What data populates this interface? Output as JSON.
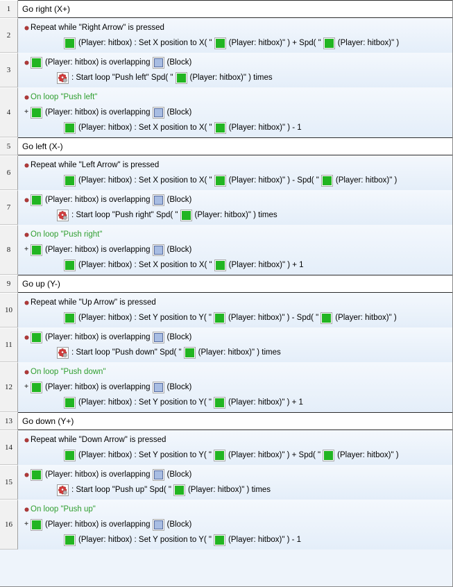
{
  "app": {
    "view": "event-list-editor",
    "colors": {
      "row_bg_top": "#f4f8fd",
      "row_bg_bottom": "#e4eef9",
      "comment_bg": "#ffffff",
      "gutter_bg": "#f1f1f1",
      "player_icon": "#22b522",
      "block_icon": "#a8bde3",
      "loop_text": "#2f9e2f",
      "bullet": "#b03a3a"
    },
    "labels": {
      "player_obj": "(Player: hitbox)",
      "block_obj": "(Block)",
      "overlapping": "is overlapping",
      "times": ") times",
      "quote": "\""
    }
  },
  "rows": [
    {
      "num": "1",
      "type": "comment",
      "text": "Go right (X+)"
    },
    {
      "num": "2",
      "type": "event",
      "lines": [
        {
          "kind": "cond",
          "marker": "red",
          "indent": 0,
          "parts": [
            {
              "t": "text",
              "v": "Repeat while \"Right Arrow\" is pressed"
            }
          ]
        },
        {
          "kind": "act",
          "marker": "none",
          "indent": 2,
          "parts": [
            {
              "t": "icon",
              "v": "player-green-icon"
            },
            {
              "t": "text",
              "v": "(Player: hitbox) : Set X position to X( \""
            },
            {
              "t": "icon",
              "v": "player-green-icon"
            },
            {
              "t": "text",
              "v": "(Player: hitbox)\" ) + Spd( \""
            },
            {
              "t": "icon",
              "v": "player-green-icon"
            },
            {
              "t": "text",
              "v": "(Player: hitbox)\" )"
            }
          ]
        }
      ]
    },
    {
      "num": "3",
      "type": "event",
      "lines": [
        {
          "kind": "cond",
          "marker": "red",
          "indent": 0,
          "parts": [
            {
              "t": "icon",
              "v": "player-green-icon"
            },
            {
              "t": "text",
              "v": "(Player: hitbox) is overlapping"
            },
            {
              "t": "icon",
              "v": "block-blue-icon"
            },
            {
              "t": "text",
              "v": "(Block)"
            }
          ]
        },
        {
          "kind": "act",
          "marker": "none",
          "indent": 3,
          "parts": [
            {
              "t": "icon",
              "v": "special-loop-gear-icon"
            },
            {
              "t": "text",
              "v": ": Start loop \"Push left\" Spd( \""
            },
            {
              "t": "icon",
              "v": "player-green-icon"
            },
            {
              "t": "text",
              "v": "(Player: hitbox)\" ) times"
            }
          ]
        }
      ]
    },
    {
      "num": "4",
      "type": "event",
      "lines": [
        {
          "kind": "cond",
          "marker": "red",
          "indent": 0,
          "green": true,
          "parts": [
            {
              "t": "text",
              "v": "On loop \"Push left\""
            }
          ]
        },
        {
          "kind": "subcond",
          "marker": "plus",
          "indent": 0,
          "parts": [
            {
              "t": "icon",
              "v": "player-green-icon"
            },
            {
              "t": "text",
              "v": "(Player: hitbox) is overlapping"
            },
            {
              "t": "icon",
              "v": "block-blue-icon"
            },
            {
              "t": "text",
              "v": "(Block)"
            }
          ]
        },
        {
          "kind": "act",
          "marker": "none",
          "indent": 2,
          "parts": [
            {
              "t": "icon",
              "v": "player-green-icon"
            },
            {
              "t": "text",
              "v": "(Player: hitbox) : Set X position to X( \""
            },
            {
              "t": "icon",
              "v": "player-green-icon"
            },
            {
              "t": "text",
              "v": "(Player: hitbox)\" ) - 1"
            }
          ]
        }
      ]
    },
    {
      "num": "5",
      "type": "comment",
      "text": "Go left (X-)"
    },
    {
      "num": "6",
      "type": "event",
      "lines": [
        {
          "kind": "cond",
          "marker": "red",
          "indent": 0,
          "parts": [
            {
              "t": "text",
              "v": "Repeat while \"Left Arrow\" is pressed"
            }
          ]
        },
        {
          "kind": "act",
          "marker": "none",
          "indent": 2,
          "parts": [
            {
              "t": "icon",
              "v": "player-green-icon"
            },
            {
              "t": "text",
              "v": "(Player: hitbox) : Set X position to X( \""
            },
            {
              "t": "icon",
              "v": "player-green-icon"
            },
            {
              "t": "text",
              "v": "(Player: hitbox)\" ) - Spd( \""
            },
            {
              "t": "icon",
              "v": "player-green-icon"
            },
            {
              "t": "text",
              "v": "(Player: hitbox)\" )"
            }
          ]
        }
      ]
    },
    {
      "num": "7",
      "type": "event",
      "lines": [
        {
          "kind": "cond",
          "marker": "red",
          "indent": 0,
          "parts": [
            {
              "t": "icon",
              "v": "player-green-icon"
            },
            {
              "t": "text",
              "v": "(Player: hitbox) is overlapping"
            },
            {
              "t": "icon",
              "v": "block-blue-icon"
            },
            {
              "t": "text",
              "v": "(Block)"
            }
          ]
        },
        {
          "kind": "act",
          "marker": "none",
          "indent": 3,
          "parts": [
            {
              "t": "icon",
              "v": "special-loop-gear-icon"
            },
            {
              "t": "text",
              "v": ": Start loop \"Push right\" Spd( \""
            },
            {
              "t": "icon",
              "v": "player-green-icon"
            },
            {
              "t": "text",
              "v": "(Player: hitbox)\" ) times"
            }
          ]
        }
      ]
    },
    {
      "num": "8",
      "type": "event",
      "lines": [
        {
          "kind": "cond",
          "marker": "red",
          "indent": 0,
          "green": true,
          "parts": [
            {
              "t": "text",
              "v": "On loop \"Push right\""
            }
          ]
        },
        {
          "kind": "subcond",
          "marker": "plus",
          "indent": 0,
          "parts": [
            {
              "t": "icon",
              "v": "player-green-icon"
            },
            {
              "t": "text",
              "v": "(Player: hitbox) is overlapping"
            },
            {
              "t": "icon",
              "v": "block-blue-icon"
            },
            {
              "t": "text",
              "v": "(Block)"
            }
          ]
        },
        {
          "kind": "act",
          "marker": "none",
          "indent": 2,
          "parts": [
            {
              "t": "icon",
              "v": "player-green-icon"
            },
            {
              "t": "text",
              "v": "(Player: hitbox) : Set X position to X( \""
            },
            {
              "t": "icon",
              "v": "player-green-icon"
            },
            {
              "t": "text",
              "v": "(Player: hitbox)\" ) + 1"
            }
          ]
        }
      ]
    },
    {
      "num": "9",
      "type": "comment",
      "text": "Go up (Y-)"
    },
    {
      "num": "10",
      "type": "event",
      "lines": [
        {
          "kind": "cond",
          "marker": "red",
          "indent": 0,
          "parts": [
            {
              "t": "text",
              "v": "Repeat while \"Up Arrow\" is pressed"
            }
          ]
        },
        {
          "kind": "act",
          "marker": "none",
          "indent": 2,
          "parts": [
            {
              "t": "icon",
              "v": "player-green-icon"
            },
            {
              "t": "text",
              "v": "(Player: hitbox) : Set Y position to Y( \""
            },
            {
              "t": "icon",
              "v": "player-green-icon"
            },
            {
              "t": "text",
              "v": "(Player: hitbox)\" ) - Spd( \""
            },
            {
              "t": "icon",
              "v": "player-green-icon"
            },
            {
              "t": "text",
              "v": "(Player: hitbox)\" )"
            }
          ]
        }
      ]
    },
    {
      "num": "11",
      "type": "event",
      "lines": [
        {
          "kind": "cond",
          "marker": "red",
          "indent": 0,
          "parts": [
            {
              "t": "icon",
              "v": "player-green-icon"
            },
            {
              "t": "text",
              "v": "(Player: hitbox) is overlapping"
            },
            {
              "t": "icon",
              "v": "block-blue-icon"
            },
            {
              "t": "text",
              "v": "(Block)"
            }
          ]
        },
        {
          "kind": "act",
          "marker": "none",
          "indent": 3,
          "parts": [
            {
              "t": "icon",
              "v": "special-loop-gear-icon"
            },
            {
              "t": "text",
              "v": ": Start loop \"Push down\" Spd( \""
            },
            {
              "t": "icon",
              "v": "player-green-icon"
            },
            {
              "t": "text",
              "v": "(Player: hitbox)\" ) times"
            }
          ]
        }
      ]
    },
    {
      "num": "12",
      "type": "event",
      "lines": [
        {
          "kind": "cond",
          "marker": "red",
          "indent": 0,
          "green": true,
          "parts": [
            {
              "t": "text",
              "v": "On loop \"Push down\""
            }
          ]
        },
        {
          "kind": "subcond",
          "marker": "plus",
          "indent": 0,
          "parts": [
            {
              "t": "icon",
              "v": "player-green-icon"
            },
            {
              "t": "text",
              "v": "(Player: hitbox) is overlapping"
            },
            {
              "t": "icon",
              "v": "block-blue-icon"
            },
            {
              "t": "text",
              "v": "(Block)"
            }
          ]
        },
        {
          "kind": "act",
          "marker": "none",
          "indent": 2,
          "parts": [
            {
              "t": "icon",
              "v": "player-green-icon"
            },
            {
              "t": "text",
              "v": "(Player: hitbox) : Set Y position to Y( \""
            },
            {
              "t": "icon",
              "v": "player-green-icon"
            },
            {
              "t": "text",
              "v": "(Player: hitbox)\" ) + 1"
            }
          ]
        }
      ]
    },
    {
      "num": "13",
      "type": "comment",
      "text": "Go down (Y+)"
    },
    {
      "num": "14",
      "type": "event",
      "lines": [
        {
          "kind": "cond",
          "marker": "red",
          "indent": 0,
          "parts": [
            {
              "t": "text",
              "v": "Repeat while \"Down Arrow\" is pressed"
            }
          ]
        },
        {
          "kind": "act",
          "marker": "none",
          "indent": 2,
          "parts": [
            {
              "t": "icon",
              "v": "player-green-icon"
            },
            {
              "t": "text",
              "v": "(Player: hitbox) : Set Y position to Y( \""
            },
            {
              "t": "icon",
              "v": "player-green-icon"
            },
            {
              "t": "text",
              "v": "(Player: hitbox)\" ) + Spd( \""
            },
            {
              "t": "icon",
              "v": "player-green-icon"
            },
            {
              "t": "text",
              "v": "(Player: hitbox)\" )"
            }
          ]
        }
      ]
    },
    {
      "num": "15",
      "type": "event",
      "lines": [
        {
          "kind": "cond",
          "marker": "red",
          "indent": 0,
          "parts": [
            {
              "t": "icon",
              "v": "player-green-icon"
            },
            {
              "t": "text",
              "v": "(Player: hitbox) is overlapping"
            },
            {
              "t": "icon",
              "v": "block-blue-icon"
            },
            {
              "t": "text",
              "v": "(Block)"
            }
          ]
        },
        {
          "kind": "act",
          "marker": "none",
          "indent": 3,
          "parts": [
            {
              "t": "icon",
              "v": "special-loop-gear-icon"
            },
            {
              "t": "text",
              "v": ": Start loop \"Push up\" Spd( \""
            },
            {
              "t": "icon",
              "v": "player-green-icon"
            },
            {
              "t": "text",
              "v": "(Player: hitbox)\" ) times"
            }
          ]
        }
      ]
    },
    {
      "num": "16",
      "type": "event",
      "lines": [
        {
          "kind": "cond",
          "marker": "red",
          "indent": 0,
          "green": true,
          "parts": [
            {
              "t": "text",
              "v": "On loop \"Push up\""
            }
          ]
        },
        {
          "kind": "subcond",
          "marker": "plus",
          "indent": 0,
          "parts": [
            {
              "t": "icon",
              "v": "player-green-icon"
            },
            {
              "t": "text",
              "v": "(Player: hitbox) is overlapping"
            },
            {
              "t": "icon",
              "v": "block-blue-icon"
            },
            {
              "t": "text",
              "v": "(Block)"
            }
          ]
        },
        {
          "kind": "act",
          "marker": "none",
          "indent": 2,
          "parts": [
            {
              "t": "icon",
              "v": "player-green-icon"
            },
            {
              "t": "text",
              "v": "(Player: hitbox) : Set Y position to Y( \""
            },
            {
              "t": "icon",
              "v": "player-green-icon"
            },
            {
              "t": "text",
              "v": "(Player: hitbox)\" ) - 1"
            }
          ]
        }
      ]
    }
  ]
}
